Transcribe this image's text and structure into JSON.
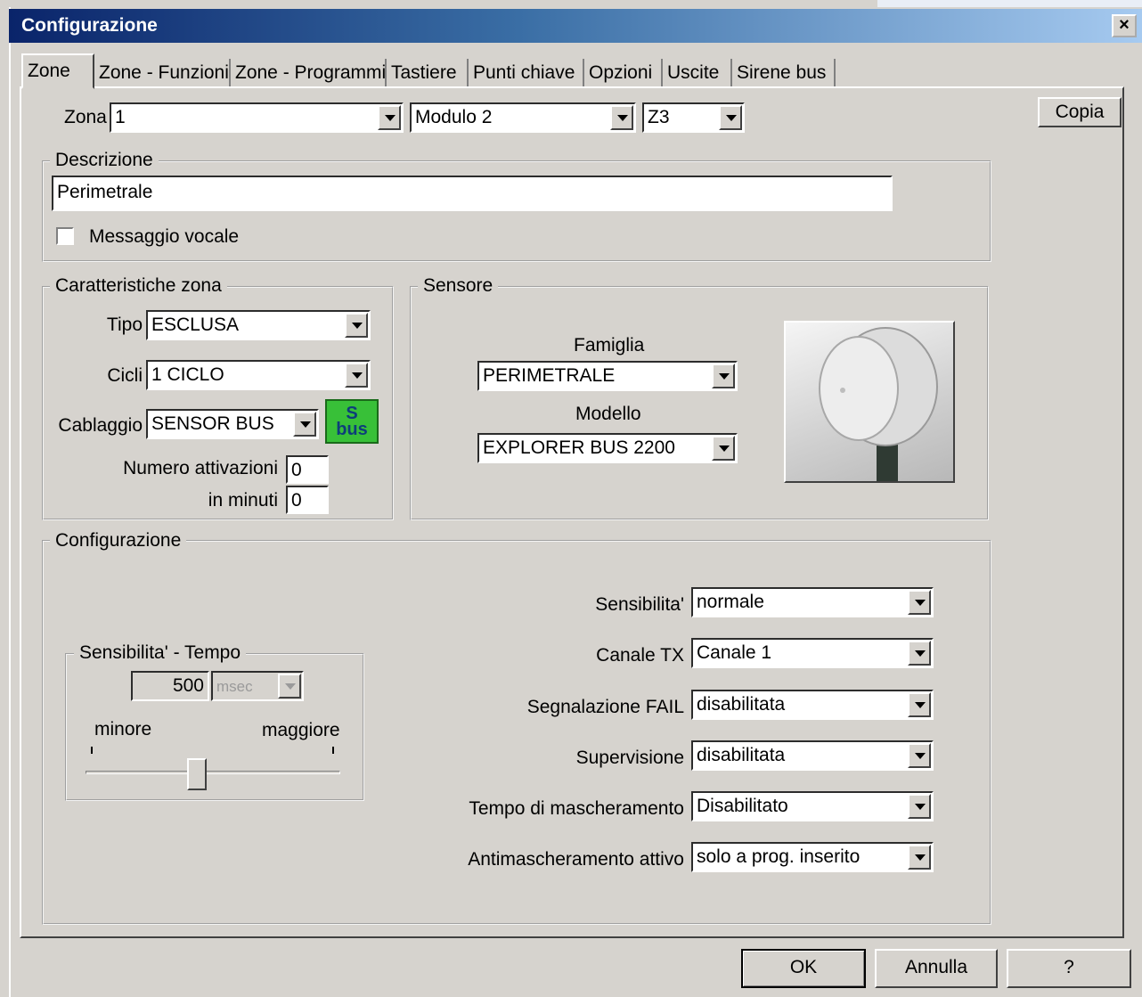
{
  "window": {
    "title": "Configurazione",
    "close": "×"
  },
  "tabs": [
    {
      "label": "Zone",
      "active": true
    },
    {
      "label": "Zone - Funzioni"
    },
    {
      "label": "Zone - Programmi"
    },
    {
      "label": "Tastiere"
    },
    {
      "label": "Punti chiave"
    },
    {
      "label": "Opzioni"
    },
    {
      "label": "Uscite"
    },
    {
      "label": "Sirene bus"
    }
  ],
  "zone_row": {
    "label": "Zona",
    "zona_value": "1",
    "modulo_value": "Modulo 2",
    "z_value": "Z3",
    "copy_button": "Copia"
  },
  "descrizione": {
    "legend": "Descrizione",
    "value": "Perimetrale",
    "voice_checkbox_label": "Messaggio vocale",
    "voice_checked": false
  },
  "caratteristiche": {
    "legend": "Caratteristiche zona",
    "tipo_label": "Tipo",
    "tipo_value": "ESCLUSA",
    "cicli_label": "Cicli",
    "cicli_value": "1  CICLO",
    "cablaggio_label": "Cablaggio",
    "cablaggio_value": "SENSOR BUS",
    "sbus_badge_top": "S",
    "sbus_badge_bottom": "bus",
    "attivazioni_label": "Numero attivazioni",
    "attivazioni_value": "0",
    "minuti_label": "in minuti",
    "minuti_value": "0"
  },
  "sensore": {
    "legend": "Sensore",
    "famiglia_label": "Famiglia",
    "famiglia_value": "PERIMETRALE",
    "modello_label": "Modello",
    "modello_value": "EXPLORER BUS 2200"
  },
  "configurazione": {
    "legend": "Configurazione",
    "sens_tempo": {
      "legend": "Sensibilita' - Tempo",
      "value": "500",
      "unit": "msec",
      "min_label": "minore",
      "max_label": "maggiore",
      "slider_fraction": 0.43
    },
    "settings": [
      {
        "label": "Sensibilita'",
        "value": "normale"
      },
      {
        "label": "Canale TX",
        "value": "Canale 1"
      },
      {
        "label": "Segnalazione FAIL",
        "value": "disabilitata"
      },
      {
        "label": "Supervisione",
        "value": "disabilitata"
      },
      {
        "label": "Tempo di mascheramento",
        "value": "Disabilitato"
      },
      {
        "label": "Antimascheramento attivo",
        "value": "solo a prog. inserito"
      }
    ]
  },
  "buttons": {
    "ok": "OK",
    "cancel": "Annulla",
    "help": "?"
  }
}
